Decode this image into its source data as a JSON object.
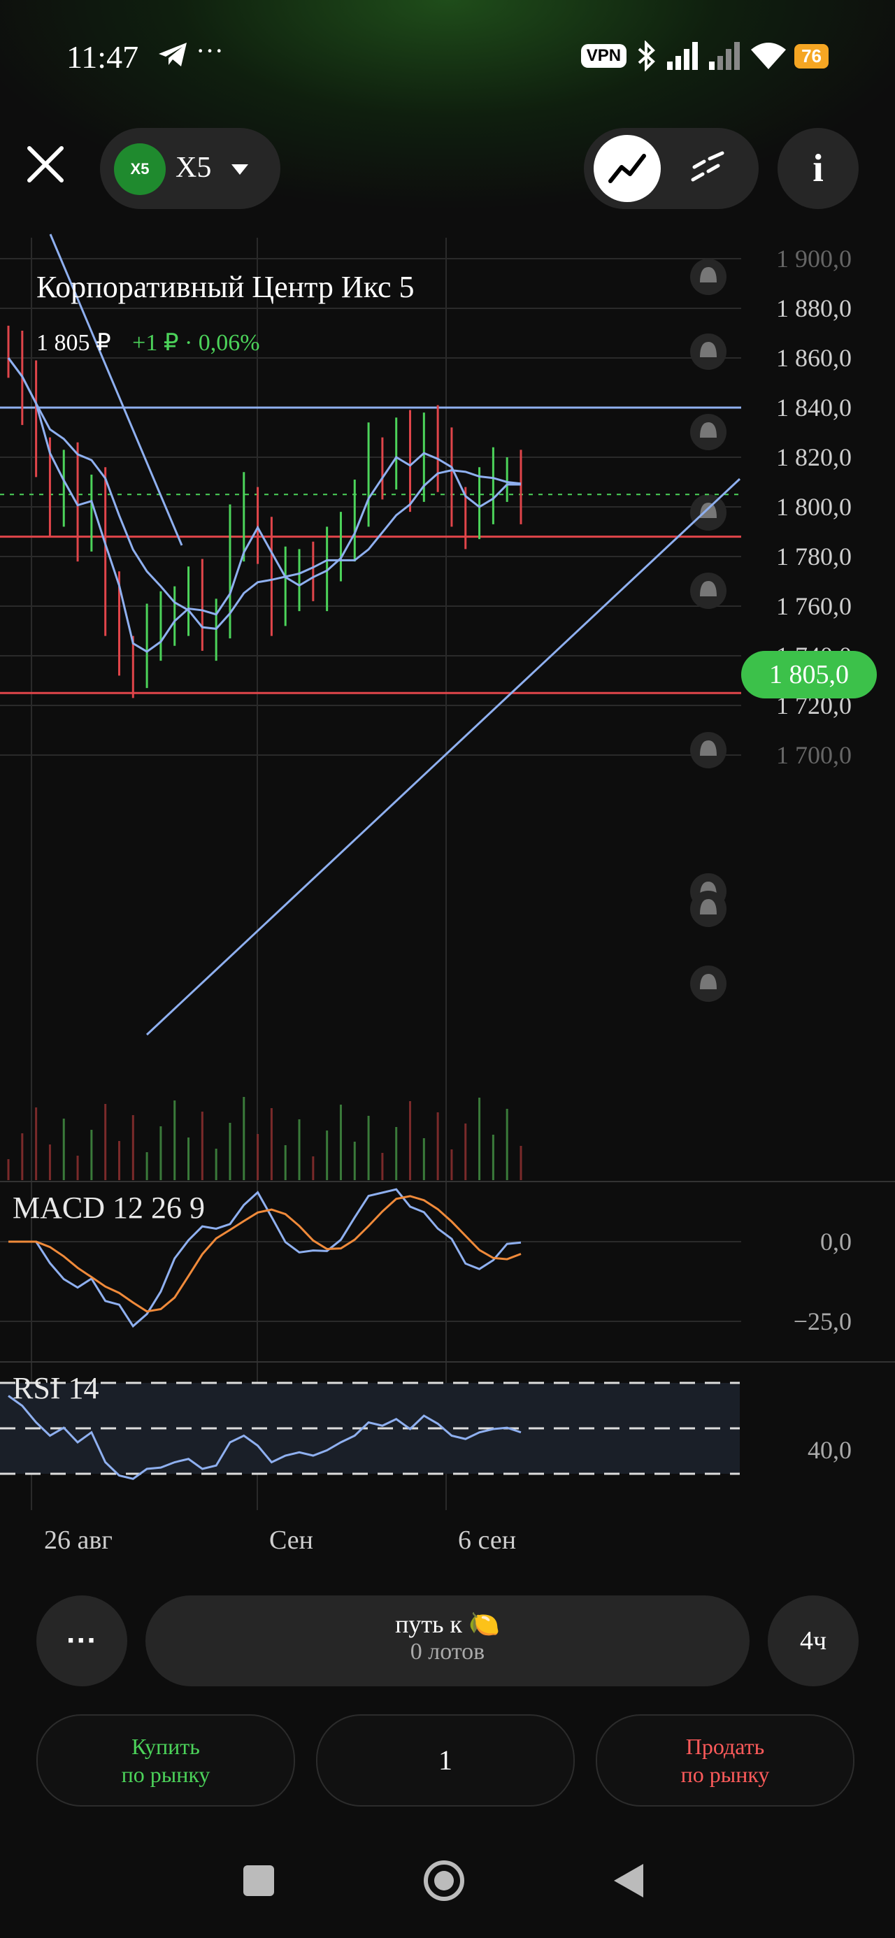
{
  "status_bar": {
    "time": "11:47",
    "extra": "···",
    "vpn": "VPN",
    "battery": "76",
    "icons": [
      "telegram-icon",
      "bluetooth-icon",
      "signal-icon",
      "signal-icon",
      "wifi-icon"
    ]
  },
  "header": {
    "ticker": "X5",
    "ticker_logo_text": "X5",
    "info_label": "i",
    "icons": [
      "close-icon",
      "chevron-down-icon",
      "line-chart-icon",
      "drawing-tools-icon"
    ]
  },
  "instrument": {
    "name": "Корпоративный Центр Икс 5",
    "price": "1 805 ₽",
    "change": "+1 ₽ · 0,06%"
  },
  "chart": {
    "current_price_tag": "1 805,0",
    "price_axis": [
      "1 900,0",
      "1 880,0",
      "1 860,0",
      "1 840,0",
      "1 820,0",
      "1 800,0",
      "1 780,0",
      "1 760,0",
      "1 740,0",
      "1 720,0",
      "1 700,0"
    ],
    "macd_label": "MACD 12 26 9",
    "macd_axis": [
      "0,0",
      "−25,0"
    ],
    "rsi_label": "RSI 14",
    "rsi_axis": [
      "40,0"
    ],
    "x_axis": [
      "26 авг",
      "Сен",
      "6 сен"
    ],
    "colors": {
      "up": "#4cd35a",
      "down": "#e0454a",
      "ma": "#8fb0f0",
      "signal": "#f08a3a"
    }
  },
  "chart_data": {
    "type": "candlestick",
    "ylim": [
      1700,
      1900
    ],
    "horizontal_levels": [
      1840,
      1788,
      1725
    ],
    "current_price": 1805,
    "closes": [
      1860,
      1845,
      1820,
      1800,
      1812,
      1790,
      1805,
      1760,
      1740,
      1735,
      1750,
      1752,
      1760,
      1765,
      1750,
      1755,
      1790,
      1800,
      1785,
      1760,
      1770,
      1775,
      1770,
      1778,
      1790,
      1800,
      1820,
      1815,
      1825,
      1810,
      1830,
      1818,
      1800,
      1795,
      1805,
      1810,
      1812,
      1805
    ]
  },
  "controls": {
    "more_label": "···",
    "strategy_title": "путь  к 🍋",
    "strategy_sub": "0 лотов",
    "timeframe": "4ч",
    "buy_line1": "Купить",
    "buy_line2": "по рынку",
    "quantity": "1",
    "sell_line1": "Продать",
    "sell_line2": "по рынку"
  }
}
